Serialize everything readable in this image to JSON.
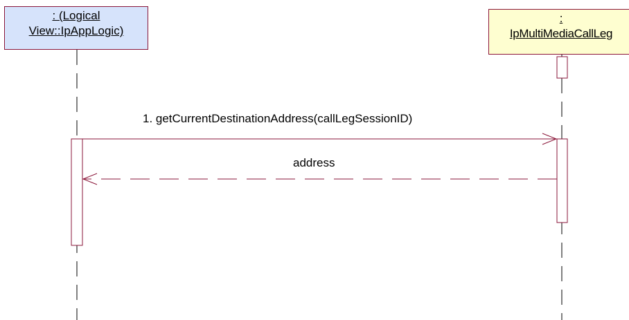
{
  "participants": [
    {
      "id": "ip-app-logic",
      "line1": ": (Logical",
      "line2": "View::IpAppLogic)",
      "fill": "#d6e3fb"
    },
    {
      "id": "ip-multimedia-call-leg",
      "line1": ":",
      "line2": "IpMultiMediaCallLeg",
      "fill": "#fefed0"
    }
  ],
  "messages": [
    {
      "number": 1,
      "text": "1. getCurrentDestinationAddress(callLegSessionID)",
      "kind": "synchronous-call"
    },
    {
      "text": "address",
      "kind": "return"
    }
  ],
  "colors": {
    "stroke": "#8a1538",
    "text": "#000000"
  }
}
